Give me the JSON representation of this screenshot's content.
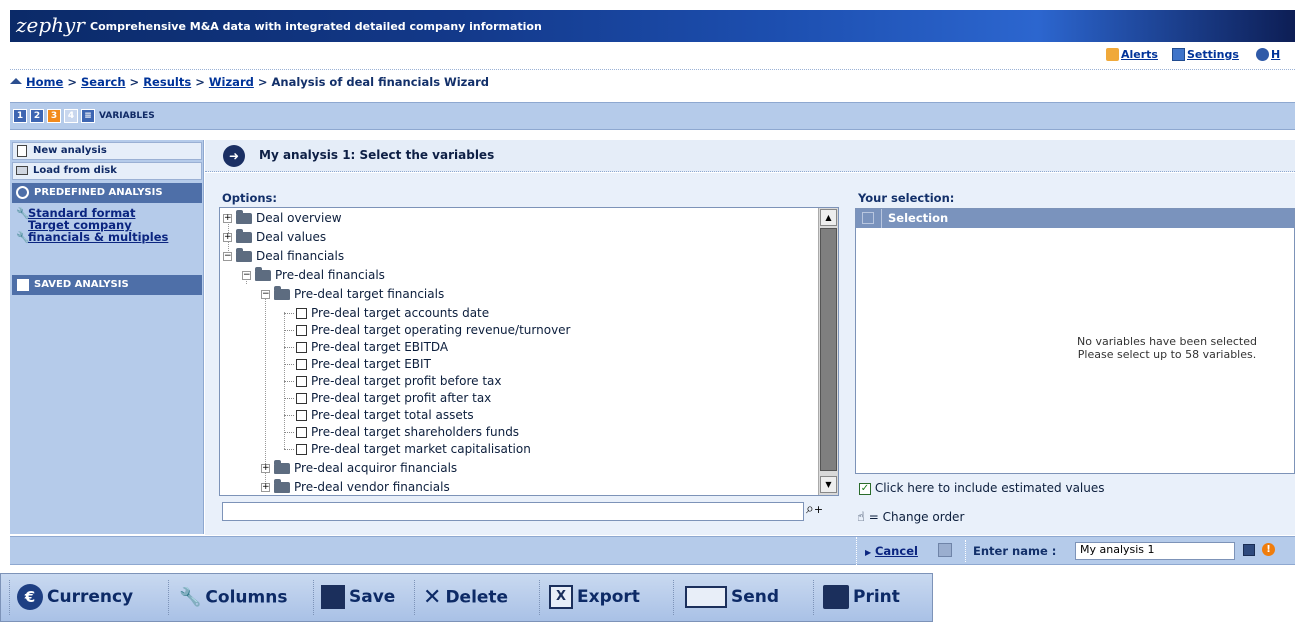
{
  "banner": {
    "logo": "zephyr",
    "tagline": "Comprehensive M&A data with integrated detailed company information"
  },
  "toplinks": {
    "alerts": "Alerts",
    "settings": "Settings",
    "help": "H"
  },
  "breadcrumb": {
    "home": "Home",
    "sep": ">",
    "search": "Search",
    "results": "Results",
    "wizard": "Wizard",
    "current": "Analysis of deal financials Wizard"
  },
  "steps": {
    "items": [
      "1",
      "2",
      "3",
      "4"
    ],
    "active": "3",
    "label": "VARIABLES"
  },
  "left": {
    "new_analysis": "New analysis",
    "load_from_disk": "Load from disk",
    "predefined_header": "PREDEFINED ANALYSIS",
    "standard_format": "Standard format",
    "target_company": "Target company financials & multiples",
    "saved_header": "SAVED ANALYSIS"
  },
  "main": {
    "title": "My analysis 1: Select the variables",
    "options_label": "Options:",
    "selection_label": "Your selection:",
    "selection_col": "Selection",
    "no_vars_1": "No variables have been selected",
    "no_vars_2": "Please select up to 58 variables.",
    "estimated": "Click here to include estimated values",
    "change_order": "= Change order"
  },
  "tree": {
    "deal_overview": "Deal overview",
    "deal_values": "Deal values",
    "deal_financials": "Deal financials",
    "pre_deal_financials": "Pre-deal financials",
    "pre_deal_target": "Pre-deal target financials",
    "items": [
      "Pre-deal target accounts date",
      "Pre-deal target operating revenue/turnover",
      "Pre-deal target EBITDA",
      "Pre-deal target EBIT",
      "Pre-deal target profit before tax",
      "Pre-deal target profit after tax",
      "Pre-deal target total assets",
      "Pre-deal target shareholders funds",
      "Pre-deal target market capitalisation"
    ],
    "acquiror": "Pre-deal acquiror financials",
    "vendor": "Pre-deal vendor financials"
  },
  "bottom": {
    "cancel": "Cancel",
    "enter_name": "Enter name :",
    "name_value": "My analysis 1"
  },
  "toolbar": {
    "currency": "Currency",
    "columns": "Columns",
    "save": "Save",
    "delete": "Delete",
    "export": "Export",
    "send": "Send",
    "print": "Print"
  }
}
